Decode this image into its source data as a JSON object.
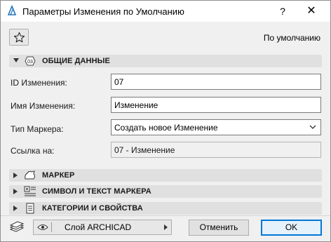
{
  "window": {
    "title": "Параметры Изменения по Умолчанию",
    "help_label": "?",
    "close_label": "✕"
  },
  "toolbar": {
    "default_label": "По умолчанию"
  },
  "sections": {
    "general": {
      "label": "ОБЩИЕ ДАННЫЕ",
      "icon_text": "03",
      "expanded": true
    },
    "marker": {
      "label": "МАРКЕР",
      "expanded": false
    },
    "symbol": {
      "label": "СИМВОЛ И ТЕКСТ МАРКЕРА",
      "expanded": false
    },
    "categories": {
      "label": "КАТЕГОРИИ И СВОЙСТВА",
      "expanded": false
    }
  },
  "fields": {
    "change_id": {
      "label": "ID Изменения:",
      "value": "07"
    },
    "change_name": {
      "label": "Имя Изменения:",
      "value": "Изменение"
    },
    "marker_type": {
      "label": "Тип Маркера:",
      "value": "Создать новое Изменение"
    },
    "link": {
      "label": "Ссылка на:",
      "value": "07 - Изменение"
    }
  },
  "footer": {
    "layer": "Слой ARCHICAD",
    "cancel_label": "Отменить",
    "ok_label": "OK"
  },
  "colors": {
    "accent": "#0078d7",
    "dialog_bg": "#f0f0f0",
    "section_bg": "#e0e0e0"
  }
}
